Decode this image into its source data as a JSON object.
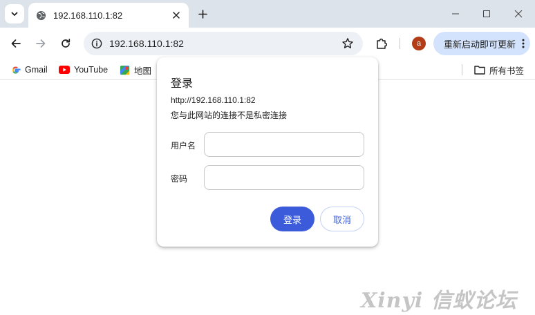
{
  "tab": {
    "title": "192.168.110.1:82"
  },
  "toolbar": {
    "url": "192.168.110.1:82",
    "avatar_letter": "a",
    "update_label": "重新启动即可更新"
  },
  "bookmarks": {
    "items": [
      {
        "label": "Gmail",
        "icon": "google-icon"
      },
      {
        "label": "YouTube",
        "icon": "youtube-icon"
      },
      {
        "label": "地图",
        "icon": "maps-icon"
      }
    ],
    "all_bookmarks": "所有书签"
  },
  "dialog": {
    "title": "登录",
    "origin": "http://192.168.110.1:82",
    "warning": "您与此网站的连接不是私密连接",
    "username_label": "用户名",
    "password_label": "密码",
    "username_value": "",
    "password_value": "",
    "login_label": "登录",
    "cancel_label": "取消"
  },
  "watermark": "Xinyi 信蚁论坛",
  "colors": {
    "accent": "#3b5bdb",
    "tabstrip": "#dde3ea",
    "update_button": "#d3e3fd",
    "avatar": "#b23c17"
  }
}
